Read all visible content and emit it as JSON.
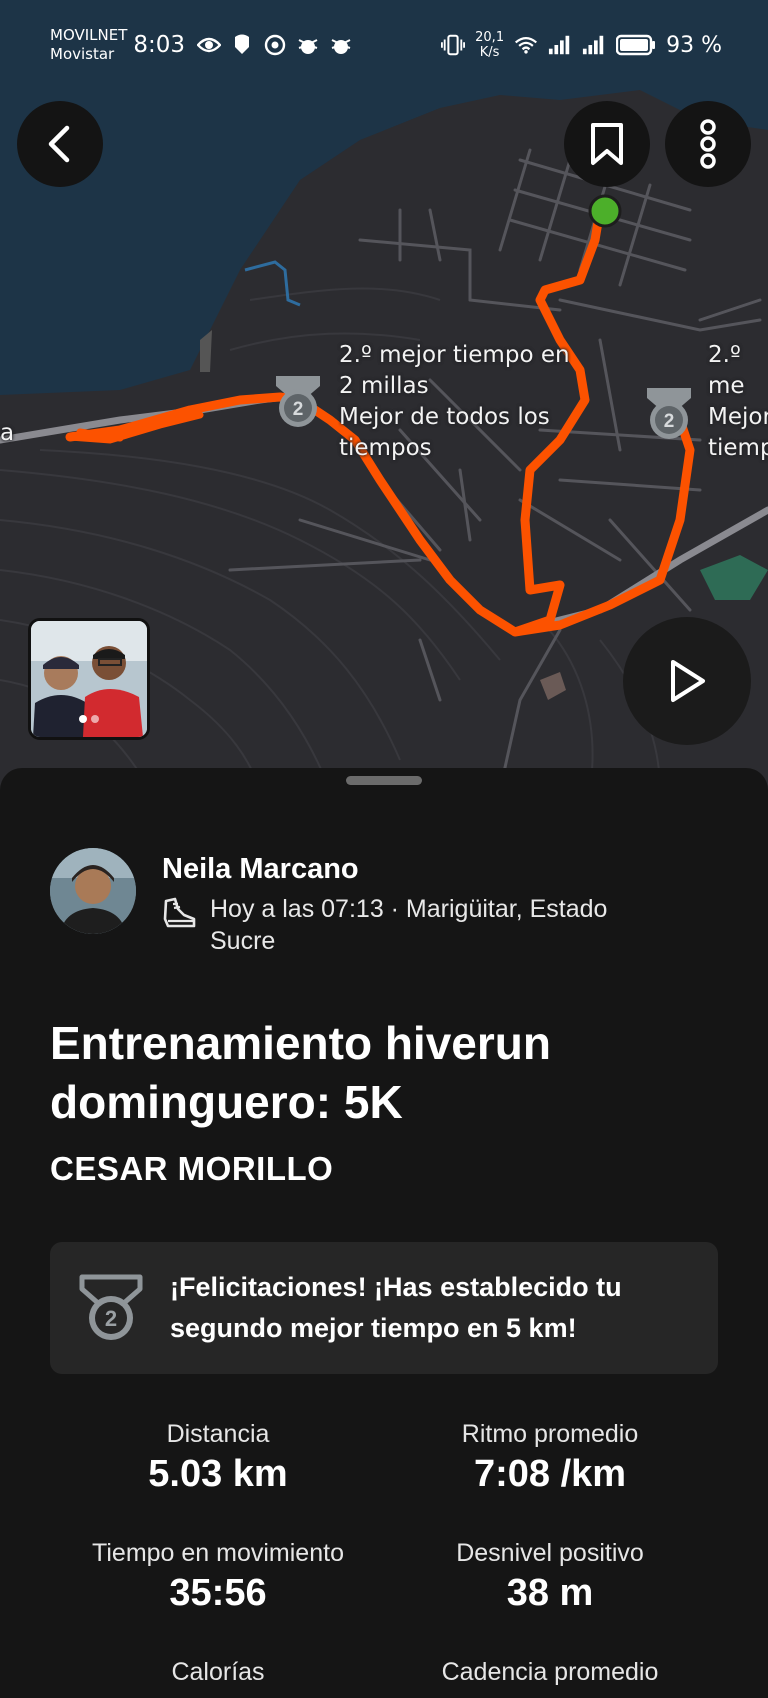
{
  "status_bar": {
    "carrier_1": "MOVILNET",
    "carrier_2": "Movistar",
    "time": "8:03",
    "speed_value": "20,1",
    "speed_unit": "K/s",
    "battery": "93 %"
  },
  "map": {
    "street_label": "a",
    "pr_label_1": "2.º mejor tiempo en\n2 millas\nMejor de todos los\ntiempos",
    "pr_label_2": "2.º me\nMejor\ntiemp",
    "route_color": "#fc5200",
    "start_color": "#4caf2a"
  },
  "activity": {
    "athlete_name": "Neila Marcano",
    "meta": "Hoy a las 07:13 · Marigüitar, Estado Sucre",
    "title": "Entrenamiento hiverun dominguero: 5K",
    "subtitle": "CESAR MORILLO",
    "achievement": "¡Felicitaciones! ¡Has establecido tu segundo mejor tiempo en 5 km!",
    "medal_number": "2"
  },
  "stats": [
    {
      "label": "Distancia",
      "value": "5.03 km"
    },
    {
      "label": "Ritmo promedio",
      "value": "7:08 /km"
    },
    {
      "label": "Tiempo en movimiento",
      "value": "35:56"
    },
    {
      "label": "Desnivel positivo",
      "value": "38 m"
    },
    {
      "label": "Calorías",
      "value": ""
    },
    {
      "label": "Cadencia promedio",
      "value": ""
    }
  ],
  "icons": {
    "back": "arrow-left-icon",
    "bookmark": "bookmark-icon",
    "more": "more-vertical-icon",
    "play": "play-icon",
    "shoe": "running-shoe-icon",
    "medal": "medal-icon"
  }
}
